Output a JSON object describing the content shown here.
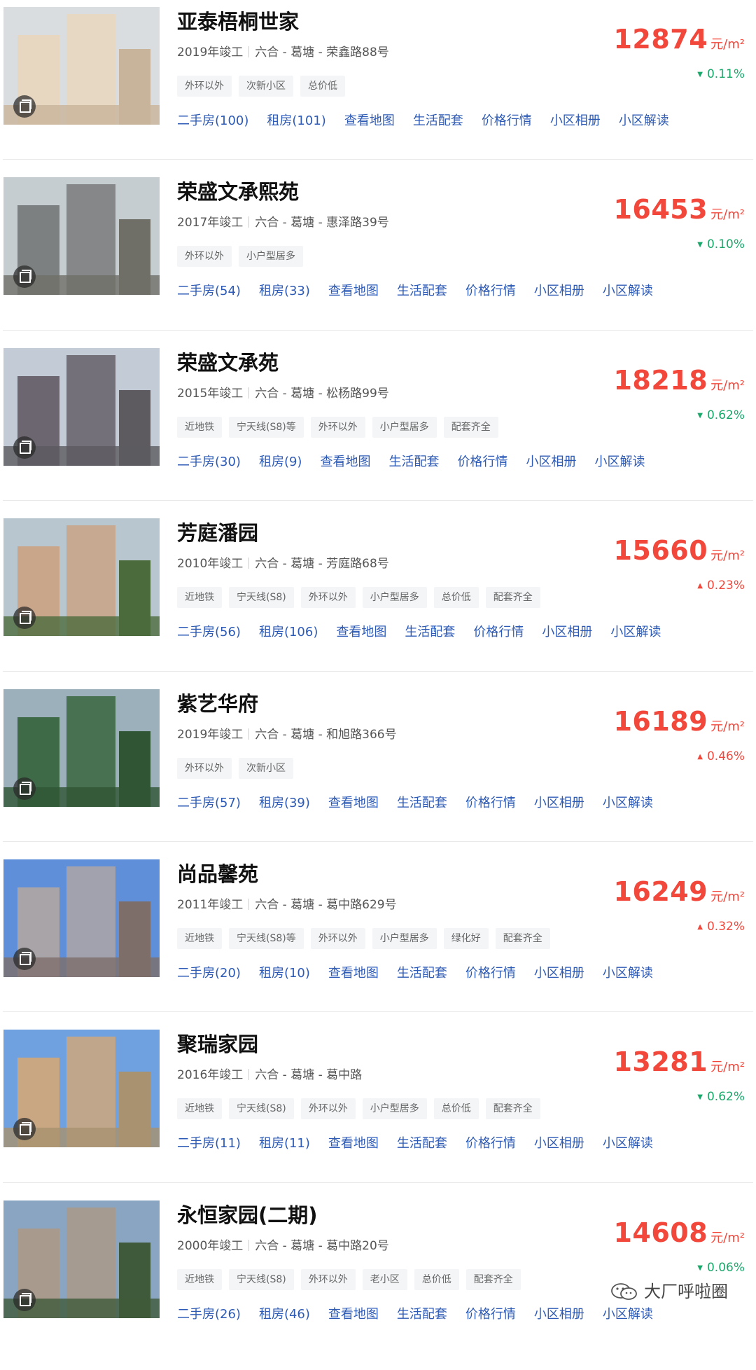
{
  "price_unit": "元/m²",
  "colors": {
    "price": "#f2483c",
    "up": "#f2483c",
    "down": "#1aa86a",
    "link": "#2d5ab4"
  },
  "icons": {
    "album": "album-icon",
    "up": "triangle-up",
    "down": "triangle-down",
    "watermark": "wechat-icon"
  },
  "communities": [
    {
      "name": "亚泰梧桐世家",
      "year": "2019年竣工",
      "location": "六合 - 葛塘 - 荣鑫路88号",
      "tags": [
        "外环以外",
        "次新小区",
        "总价低"
      ],
      "price": "12874",
      "change": "0.11%",
      "direction": "down",
      "links": [
        "二手房(100)",
        "租房(101)",
        "查看地图",
        "生活配套",
        "价格行情",
        "小区相册",
        "小区解读"
      ]
    },
    {
      "name": "荣盛文承熙苑",
      "year": "2017年竣工",
      "location": "六合 - 葛塘 - 惠泽路39号",
      "tags": [
        "外环以外",
        "小户型居多"
      ],
      "price": "16453",
      "change": "0.10%",
      "direction": "down",
      "links": [
        "二手房(54)",
        "租房(33)",
        "查看地图",
        "生活配套",
        "价格行情",
        "小区相册",
        "小区解读"
      ]
    },
    {
      "name": "荣盛文承苑",
      "year": "2015年竣工",
      "location": "六合 - 葛塘 - 松杨路99号",
      "tags": [
        "近地铁",
        "宁天线(S8)等",
        "外环以外",
        "小户型居多",
        "配套齐全"
      ],
      "price": "18218",
      "change": "0.62%",
      "direction": "down",
      "links": [
        "二手房(30)",
        "租房(9)",
        "查看地图",
        "生活配套",
        "价格行情",
        "小区相册",
        "小区解读"
      ]
    },
    {
      "name": "芳庭潘园",
      "year": "2010年竣工",
      "location": "六合 - 葛塘 - 芳庭路68号",
      "tags": [
        "近地铁",
        "宁天线(S8)",
        "外环以外",
        "小户型居多",
        "总价低",
        "配套齐全"
      ],
      "price": "15660",
      "change": "0.23%",
      "direction": "up",
      "links": [
        "二手房(56)",
        "租房(106)",
        "查看地图",
        "生活配套",
        "价格行情",
        "小区相册",
        "小区解读"
      ]
    },
    {
      "name": "紫艺华府",
      "year": "2019年竣工",
      "location": "六合 - 葛塘 - 和旭路366号",
      "tags": [
        "外环以外",
        "次新小区"
      ],
      "price": "16189",
      "change": "0.46%",
      "direction": "up",
      "links": [
        "二手房(57)",
        "租房(39)",
        "查看地图",
        "生活配套",
        "价格行情",
        "小区相册",
        "小区解读"
      ]
    },
    {
      "name": "尚品馨苑",
      "year": "2011年竣工",
      "location": "六合 - 葛塘 - 葛中路629号",
      "tags": [
        "近地铁",
        "宁天线(S8)等",
        "外环以外",
        "小户型居多",
        "绿化好",
        "配套齐全"
      ],
      "price": "16249",
      "change": "0.32%",
      "direction": "up",
      "links": [
        "二手房(20)",
        "租房(10)",
        "查看地图",
        "生活配套",
        "价格行情",
        "小区相册",
        "小区解读"
      ]
    },
    {
      "name": "聚瑞家园",
      "year": "2016年竣工",
      "location": "六合 - 葛塘 - 葛中路",
      "tags": [
        "近地铁",
        "宁天线(S8)",
        "外环以外",
        "小户型居多",
        "总价低",
        "配套齐全"
      ],
      "price": "13281",
      "change": "0.62%",
      "direction": "down",
      "links": [
        "二手房(11)",
        "租房(11)",
        "查看地图",
        "生活配套",
        "价格行情",
        "小区相册",
        "小区解读"
      ]
    },
    {
      "name": "永恒家园(二期)",
      "year": "2000年竣工",
      "location": "六合 - 葛塘 - 葛中路20号",
      "tags": [
        "近地铁",
        "宁天线(S8)",
        "外环以外",
        "老小区",
        "总价低",
        "配套齐全"
      ],
      "price": "14608",
      "change": "0.06%",
      "direction": "down",
      "links": [
        "二手房(26)",
        "租房(46)",
        "查看地图",
        "生活配套",
        "价格行情",
        "小区相册",
        "小区解读"
      ]
    }
  ],
  "watermark": "大厂呼啦圈"
}
